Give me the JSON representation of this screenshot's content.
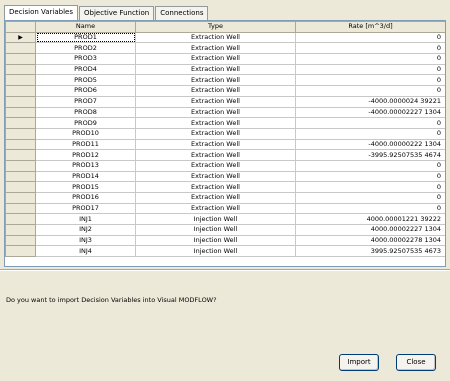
{
  "tabs": [
    "Decision Variables",
    "Objective Function",
    "Connections"
  ],
  "columns": [
    "",
    "Name",
    "Type",
    "Rate [m^3/d]"
  ],
  "rows": [
    {
      "name": "PROD1",
      "type": "Extraction Well",
      "rate": "0",
      "current": true
    },
    {
      "name": "PROD2",
      "type": "Extraction Well",
      "rate": "0"
    },
    {
      "name": "PROD3",
      "type": "Extraction Well",
      "rate": "0"
    },
    {
      "name": "PROD4",
      "type": "Extraction Well",
      "rate": "0"
    },
    {
      "name": "PROD5",
      "type": "Extraction Well",
      "rate": "0"
    },
    {
      "name": "PROD6",
      "type": "Extraction Well",
      "rate": "0"
    },
    {
      "name": "PROD7",
      "type": "Extraction Well",
      "rate": "-4000.0000024 39221"
    },
    {
      "name": "PROD8",
      "type": "Extraction Well",
      "rate": "-4000.00002227 1304"
    },
    {
      "name": "PROD9",
      "type": "Extraction Well",
      "rate": "0"
    },
    {
      "name": "PROD10",
      "type": "Extraction Well",
      "rate": "0"
    },
    {
      "name": "PROD11",
      "type": "Extraction Well",
      "rate": "-4000.00000222 1304"
    },
    {
      "name": "PROD12",
      "type": "Extraction Well",
      "rate": "-3995.92507535 4674"
    },
    {
      "name": "PROD13",
      "type": "Extraction Well",
      "rate": "0"
    },
    {
      "name": "PROD14",
      "type": "Extraction Well",
      "rate": "0"
    },
    {
      "name": "PROD15",
      "type": "Extraction Well",
      "rate": "0"
    },
    {
      "name": "PROD16",
      "type": "Extraction Well",
      "rate": "0"
    },
    {
      "name": "PROD17",
      "type": "Extraction Well",
      "rate": "0"
    },
    {
      "name": "INJ1",
      "type": "Injection Well",
      "rate": "4000.00001221 39222"
    },
    {
      "name": "INJ2",
      "type": "Injection Well",
      "rate": "4000.00002227 1304"
    },
    {
      "name": "INJ3",
      "type": "Injection Well",
      "rate": "4000.00002278 1304"
    },
    {
      "name": "INJ4",
      "type": "Injection Well",
      "rate": "3995.92507535 4673"
    }
  ],
  "prompt": "Do you want to import Decision Variables into Visual MODFLOW?",
  "buttons": {
    "import": "Import",
    "close": "Close"
  }
}
